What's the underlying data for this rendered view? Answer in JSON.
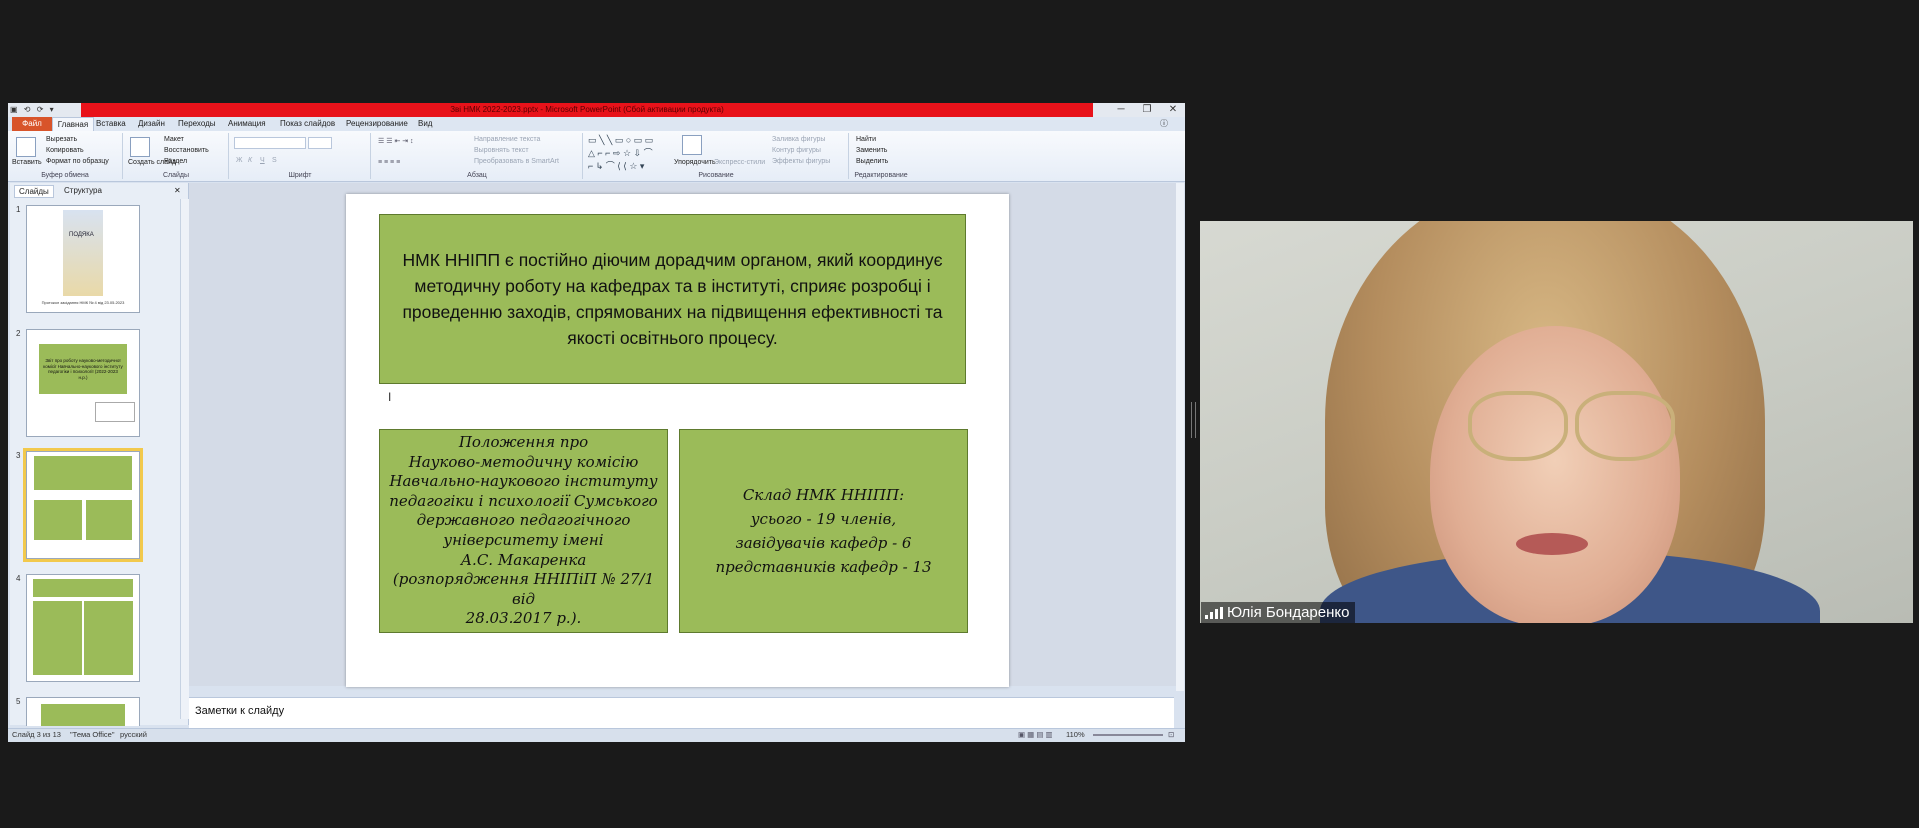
{
  "window": {
    "title": "Зві НМК 2022-2023.pptx - Microsoft PowerPoint (Сбой активации продукта)",
    "minimize": "─",
    "restore": "❐",
    "close": "✕"
  },
  "tabs": [
    "Файл",
    "Главная",
    "Вставка",
    "Дизайн",
    "Переходы",
    "Анимация",
    "Показ слайдов",
    "Рецензирование",
    "Вид"
  ],
  "ribbon": {
    "clipboard": {
      "paste": "Вставить",
      "cut": "Вырезать",
      "copy": "Копировать",
      "format": "Формат по образцу",
      "group": "Буфер обмена"
    },
    "slides": {
      "layout": "Макет",
      "reset": "Восстановить",
      "new": "Создать слайд",
      "section": "Раздел",
      "group": "Слайды"
    },
    "font": {
      "group": "Шрифт",
      "bold": "Ж",
      "italic": "К",
      "underline": "Ч",
      "strike": "S"
    },
    "paragraph": {
      "direction": "Направление текста",
      "align": "Выровнять текст",
      "smartart": "Преобразовать в SmartArt",
      "group": "Абзац"
    },
    "drawing": {
      "arrange": "Упорядочить",
      "quickstyles": "Экспресс-стили",
      "fill": "Заливка фигуры",
      "outline": "Контур фигуры",
      "effects": "Эффекты фигуры",
      "group": "Рисование"
    },
    "editing": {
      "find": "Найти",
      "replace": "Заменить",
      "select": "Выделить",
      "group": "Редактирование"
    }
  },
  "panel": {
    "tab_slides": "Слайды",
    "tab_outline": "Структура",
    "thumbs": [
      {
        "num": "1",
        "caption": "Протокол засідання НМК № 4 від 23.05.2023",
        "title": "ПОДЯКА"
      },
      {
        "num": "2",
        "caption": "Звіт про роботу науково-методичної комісії Навчально-наукового інституту педагогіки і психології (2022-2023 н.р.)"
      },
      {
        "num": "3"
      },
      {
        "num": "4"
      },
      {
        "num": "5"
      }
    ]
  },
  "slide": {
    "top_text": "НМК ННІПП є постійно діючим дорадчим органом, який координує методичну роботу на кафедрах та в інституті, сприяє розробці і проведенню заходів, спрямованих на підвищення ефективності та якості освітнього процесу.",
    "left_lines": [
      "Положення про",
      "Науково-методичну комісію",
      "Навчально-наукового інституту",
      "педагогіки і психології Сумського",
      "державного педагогічного",
      "університету імені",
      "А.С. Макаренка",
      "(розпорядження ННІПіП № 27/1 від",
      "28.03.2017 р.)."
    ],
    "right_lines": [
      "Склад НМК ННІПП:",
      "усього - 19 членів,",
      "завідувачів кафедр - 6",
      "представників кафедр - 13"
    ]
  },
  "notes_placeholder": "Заметки к слайду",
  "status": {
    "slide": "Слайд 3 из 13",
    "theme": "\"Тема Office\"",
    "lang": "русский",
    "zoom": "110%"
  },
  "participant": {
    "name": "Юлія Бондаренко"
  },
  "colors": {
    "slide_box": "#9bbb59",
    "title_bar": "#e8121a",
    "file_tab": "#d8542a"
  }
}
